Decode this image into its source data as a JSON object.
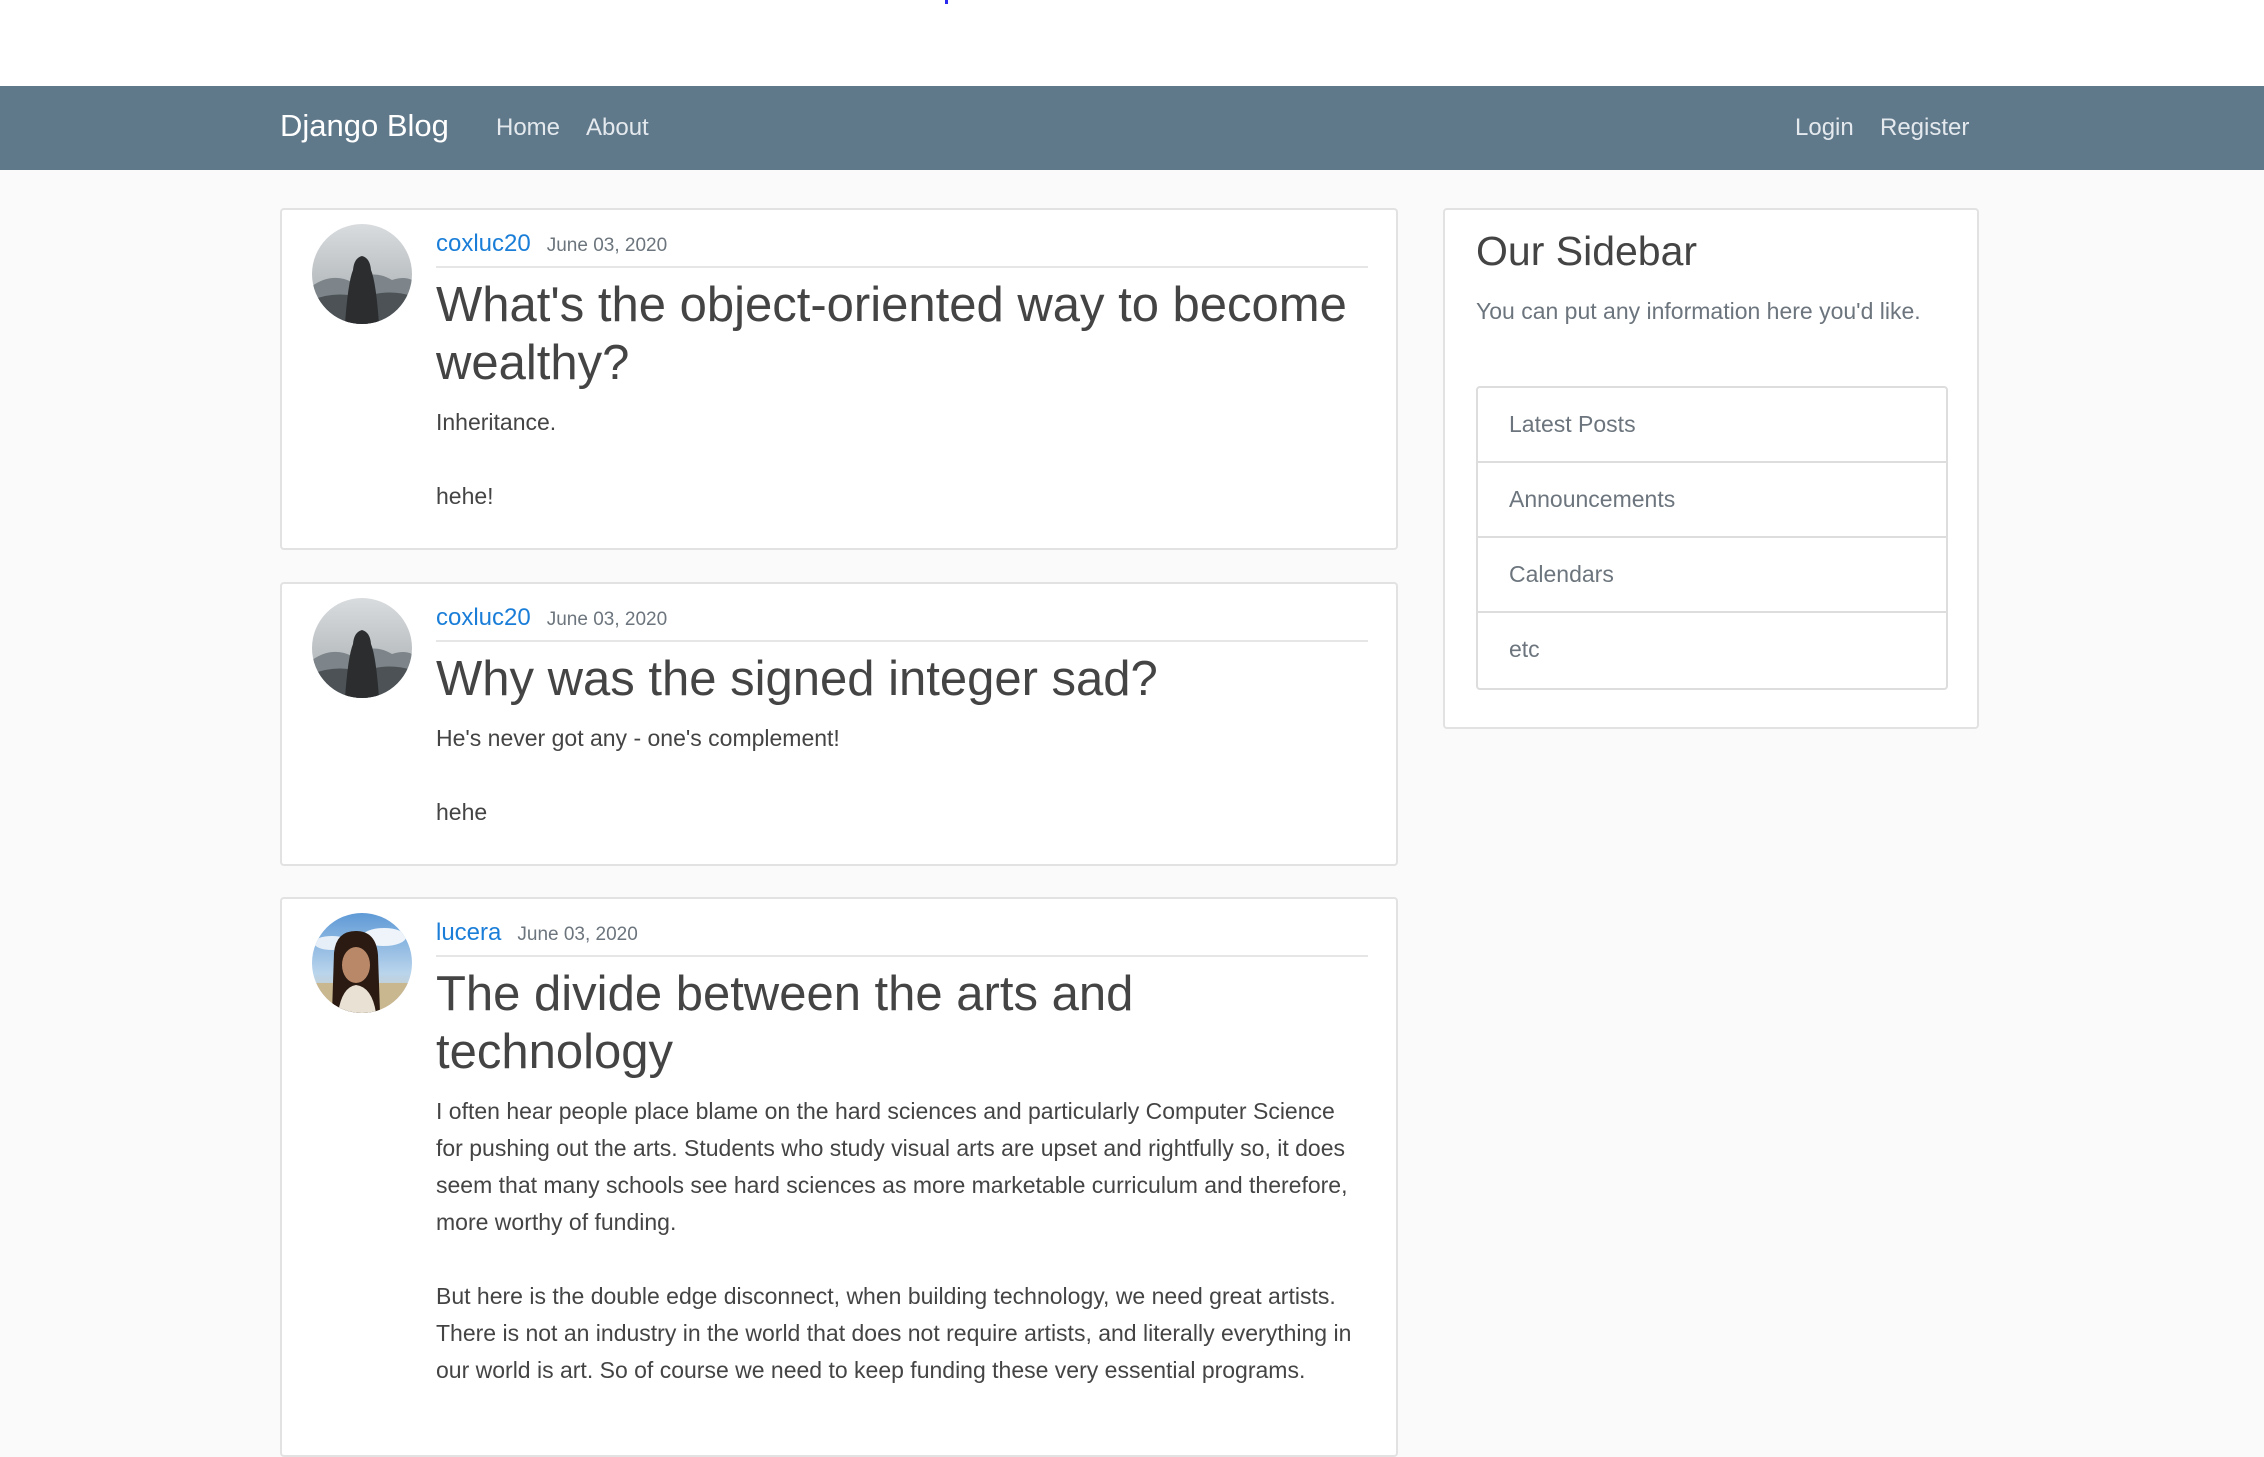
{
  "navbar": {
    "brand": "Django Blog",
    "left_links": [
      "Home",
      "About"
    ],
    "right_links": [
      "Login",
      "Register"
    ],
    "bg_color": "#5f788a"
  },
  "posts": [
    {
      "author": "coxluc20",
      "date": "June 03, 2020",
      "title": "What's the object-oriented way to become wealthy?",
      "paragraphs": [
        "Inheritance.",
        "hehe!"
      ],
      "avatar_icon": "hooded-figure-in-fog-avatar"
    },
    {
      "author": "coxluc20",
      "date": "June 03, 2020",
      "title": "Why was the signed integer sad?",
      "paragraphs": [
        "He's never got any - one's complement!",
        "hehe"
      ],
      "avatar_icon": "hooded-figure-in-fog-avatar"
    },
    {
      "author": "lucera",
      "date": "June 03, 2020",
      "title": "The divide between the arts and technology",
      "paragraphs": [
        "I often hear people place blame on the hard sciences and particularly Computer Science for pushing out the arts. Students who study visual arts are upset and rightfully so, it does seem that many schools see hard sciences as more marketable curriculum and therefore, more worthy of funding.",
        "But here is the double edge disconnect, when building technology, we need great artists. There is not an industry in the world that does not require artists, and literally everything in our world is art. So of course we need to keep funding these very essential programs."
      ],
      "avatar_icon": "woman-portrait-sky-avatar"
    }
  ],
  "sidebar": {
    "title": "Our Sidebar",
    "description": "You can put any information here you'd like.",
    "items": [
      "Latest Posts",
      "Announcements",
      "Calendars",
      "etc"
    ]
  },
  "colors": {
    "link": "#1a7ed8",
    "muted": "#6c757d",
    "text": "#444444",
    "page_bg": "#fafafa"
  }
}
